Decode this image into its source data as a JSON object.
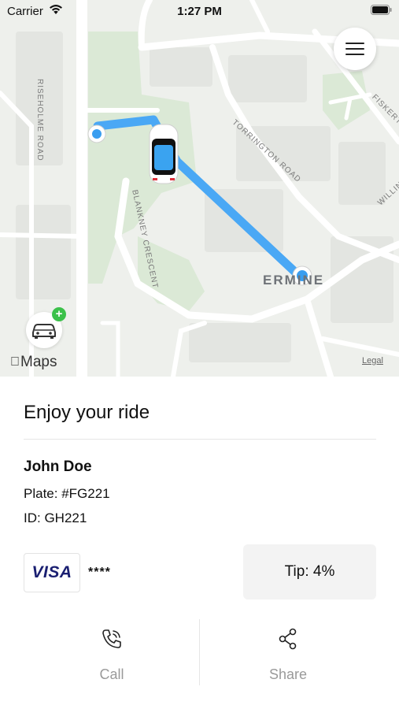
{
  "status_bar": {
    "carrier": "Carrier",
    "time": "1:27 PM"
  },
  "map": {
    "streets": {
      "risholme_road": "RISEHOLME ROAD",
      "torrington_road": "TORRINGTON ROAD",
      "blankney_crescent": "BLANKNEY CRESCENT",
      "fiskerton": "FISKERT",
      "willingham": "WILLING"
    },
    "area_label": "ERMINE",
    "maps_brand": "Maps",
    "legal": "Legal",
    "route_color": "#4aa8f5",
    "car_color": "#3aa3f0"
  },
  "ride": {
    "title": "Enjoy your ride",
    "driver_name": "John Doe",
    "plate": "Plate: #FG221",
    "id": "ID: GH221"
  },
  "payment": {
    "brand": "VISA",
    "masked_number": "****"
  },
  "tip": {
    "label": "Tip: 4%"
  },
  "actions": {
    "call": {
      "label": "Call",
      "icon": "phone-icon"
    },
    "share": {
      "label": "Share",
      "icon": "share-icon"
    }
  }
}
